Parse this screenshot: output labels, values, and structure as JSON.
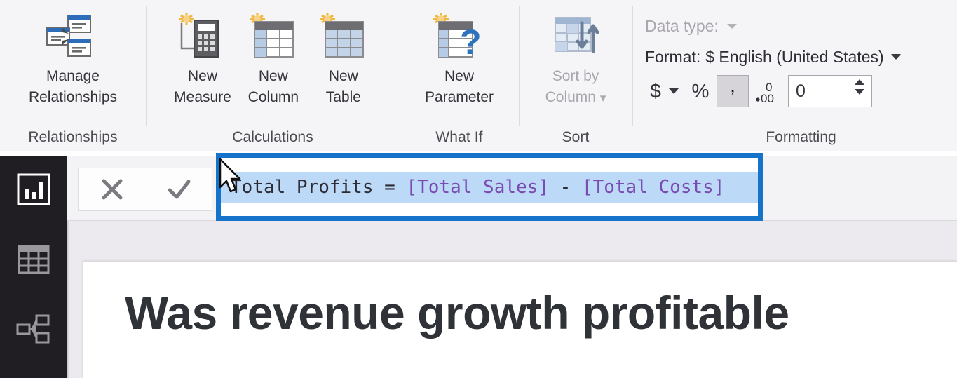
{
  "ribbon": {
    "groups": [
      {
        "name": "relationships",
        "label": "Relationships",
        "buttons": [
          {
            "id": "manage-relationships",
            "line1": "Manage",
            "line2": "Relationships",
            "icon": "relationships-icon",
            "disabled": false,
            "caret": false
          }
        ]
      },
      {
        "name": "calculations",
        "label": "Calculations",
        "buttons": [
          {
            "id": "new-measure",
            "line1": "New",
            "line2": "Measure",
            "icon": "new-measure-icon",
            "disabled": false,
            "caret": false
          },
          {
            "id": "new-column",
            "line1": "New",
            "line2": "Column",
            "icon": "new-column-icon",
            "disabled": false,
            "caret": false
          },
          {
            "id": "new-table",
            "line1": "New",
            "line2": "Table",
            "icon": "new-table-icon",
            "disabled": false,
            "caret": false
          }
        ]
      },
      {
        "name": "what-if",
        "label": "What If",
        "buttons": [
          {
            "id": "new-parameter",
            "line1": "New",
            "line2": "Parameter",
            "icon": "new-parameter-icon",
            "disabled": false,
            "caret": false
          }
        ]
      },
      {
        "name": "sort",
        "label": "Sort",
        "buttons": [
          {
            "id": "sort-by-column",
            "line1": "Sort by",
            "line2": "Column",
            "icon": "sort-by-column-icon",
            "disabled": true,
            "caret": true
          }
        ]
      }
    ],
    "formatting": {
      "label": "Formatting",
      "data_type_label": "Data type:",
      "format_label": "Format:",
      "format_value": "$ English (United States)",
      "currency_symbol": "$",
      "percent_symbol": "%",
      "thousands_symbol": ",",
      "decimal_icon": ".00",
      "decimal_places": "0"
    }
  },
  "sidebar": {
    "items": [
      {
        "id": "report-view",
        "icon": "bar-chart-icon",
        "selected": true
      },
      {
        "id": "data-view",
        "icon": "table-grid-icon",
        "selected": false
      },
      {
        "id": "model-view",
        "icon": "model-relationships-icon",
        "selected": false
      }
    ]
  },
  "formula_bar": {
    "cancel_icon": "close-x-icon",
    "commit_icon": "checkmark-icon",
    "measure_name": "Total Profits",
    "equals": " = ",
    "ref_sales": "[Total Sales]",
    "operator": " - ",
    "ref_costs": "[Total Costs]",
    "full_text": "Total Profits = [Total Sales] - [Total Costs]",
    "selected": true,
    "highlight_color": "#1573c9",
    "selection_color": "#bcd9f7",
    "reference_token_color": "#7a4bb0"
  },
  "report": {
    "title": "Was revenue growth profitable"
  }
}
